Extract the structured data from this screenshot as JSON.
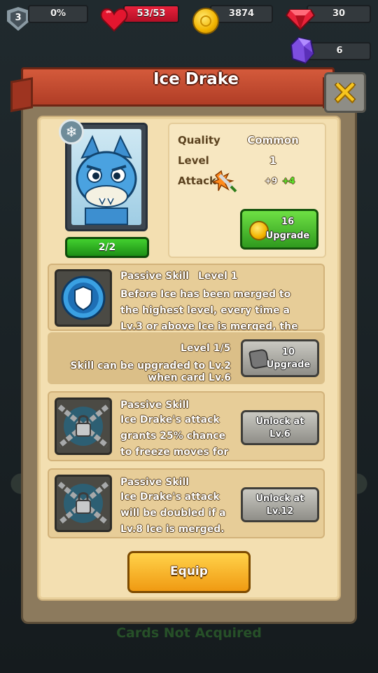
{
  "hud": {
    "level": "3",
    "progress": "0%",
    "health": "53/53",
    "coins": "3874",
    "rubies": "30",
    "crystals": "6"
  },
  "popup": {
    "title": "Ice Drake",
    "close_icon": "close-x-icon",
    "card_count": "2/2",
    "stats": {
      "quality_label": "Quality",
      "quality_value": "Common",
      "level_label": "Level",
      "level_value": "1",
      "attack_label": "Attack",
      "attack_value": "+9",
      "attack_bonus": "+4"
    },
    "upgrade_button": {
      "cost": "16",
      "label": "Upgrade"
    },
    "skill1": {
      "title": "Passive Skill",
      "level": "Level 1",
      "description": "Before Ice has been merged to the highest level, every time a Lv.3 or above Ice is merged, the",
      "skill_level": "Level 1/5",
      "note_line1": "Skill can be upgraded to Lv.2",
      "note_line2": "when card Lv.6",
      "button_cost": "10",
      "button_label": "Upgrade"
    },
    "skill2": {
      "title": "Passive Skill",
      "description": "Ice Drake's attack grants 25% chance to freeze moves for",
      "button_line1": "Unlock at",
      "button_line2": "Lv.6"
    },
    "skill3": {
      "title": "Passive Skill",
      "description": "Ice Drake's attack will be doubled if a Lv.8 Ice is merged.",
      "button_line1": "Unlock at",
      "button_line2": "Lv.12"
    },
    "equip_label": "Equip"
  },
  "footer": {
    "text": "Cards Not Acquired"
  },
  "colors": {
    "accent_green": "#43d02f",
    "ribbon_red": "#d45a3b",
    "equip_gold": "#ffd24a"
  }
}
